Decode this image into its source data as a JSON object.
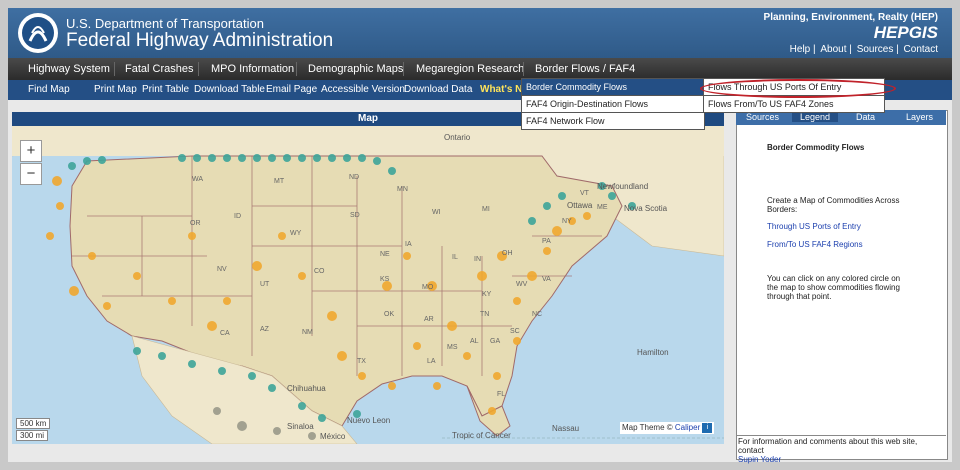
{
  "header": {
    "dept": "U.S. Department of Transportation",
    "agency": "Federal Highway Administration",
    "office": "Planning, Environment, Realty (HEP)",
    "app": "HEPGIS",
    "links": [
      "Help",
      "About",
      "Sources",
      "Contact"
    ]
  },
  "nav": {
    "items": [
      "Highway System",
      "Fatal Crashes",
      "MPO Information",
      "Demographic Maps",
      "Megaregion Research",
      "Border Flows / FAF4"
    ]
  },
  "subnav": {
    "items": [
      "Find Map",
      "Print Map",
      "Print Table",
      "Download Table",
      "Email Page",
      "Accessible Version",
      "Download Data",
      "What's N"
    ]
  },
  "dropdown": {
    "items": [
      "Border Commodity Flows",
      "FAF4 Origin-Destination Flows",
      "FAF4 Network Flow"
    ],
    "submenu": [
      "Flows Through US Ports Of Entry",
      "Flows From/To US FAF4 Zones"
    ]
  },
  "map": {
    "title": "Map",
    "zoom_in": "+",
    "zoom_out": "−",
    "scale_km": "500 km",
    "scale_mi": "300 mi",
    "theme": "Map Theme ©",
    "theme_link": "Caliper",
    "labels": [
      "Ontario",
      "Newfoundland",
      "Nova Scotia",
      "Ottawa",
      "Hamilton",
      "Chihuahua",
      "Sinaloa",
      "Nuevo Leon",
      "México",
      "Tropic of Cancer",
      "Nassau"
    ],
    "states": [
      "WA",
      "MT",
      "ND",
      "MN",
      "OR",
      "ID",
      "SD",
      "WI",
      "MI",
      "WY",
      "NE",
      "IA",
      "NV",
      "UT",
      "CO",
      "KS",
      "MO",
      "IL",
      "IN",
      "OH",
      "PA",
      "NY",
      "VT",
      "ME",
      "CA",
      "AZ",
      "NM",
      "OK",
      "AR",
      "TN",
      "KY",
      "WV",
      "VA",
      "NC",
      "TX",
      "LA",
      "MS",
      "AL",
      "GA",
      "SC",
      "FL"
    ]
  },
  "panel": {
    "tabs": [
      "Sources",
      "Legend",
      "Data",
      "Layers"
    ],
    "active_tab": "Legend",
    "heading": "Border Commodity Flows",
    "intro": "Create a Map of Commodities Across Borders:",
    "link1": "Through US Ports of Entry",
    "link2": "From/To US FAF4 Regions",
    "help": "You can click on any colored circle on the map to show commodities flowing through that point.",
    "footer_text": "For information and comments about this web site, contact",
    "footer_link": "Supin Yoder"
  },
  "colors": {
    "header_blue": "#3d6b9c",
    "nav_dark": "#2b2b2b",
    "subnav_blue": "#244f85",
    "water": "#b9d8ec",
    "land": "#efe7cc",
    "us_land": "#e6dcb4",
    "state_border": "#a06a6a",
    "port_teal": "#3ea59a",
    "region_orange": "#f0a830",
    "mexico_gray": "#9a9a8a",
    "highlight_red": "#c0222a"
  }
}
